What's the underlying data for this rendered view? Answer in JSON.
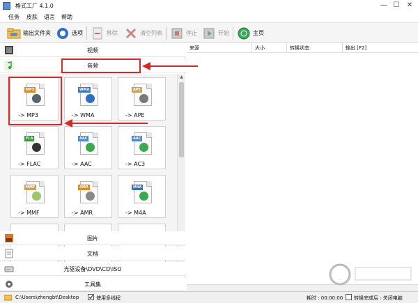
{
  "window": {
    "title": "格式工厂 4.1.0",
    "controls": {
      "minimize": "—",
      "maximize": "☐",
      "close": "✕"
    }
  },
  "menu": [
    "任务",
    "皮肤",
    "语言",
    "帮助"
  ],
  "toolbar": {
    "output_folder": "输出文件夹",
    "options": "选项",
    "remove": "移除",
    "clear_list": "清空列表",
    "stop": "停止",
    "start": "开始",
    "home": "主页"
  },
  "categories": {
    "video": "视频",
    "audio": "音频",
    "picture": "图片",
    "document": "文档",
    "rom": "光驱设备\\DVD\\CD\\ISO",
    "tools": "工具集"
  },
  "tiles": [
    {
      "tag": "MP3",
      "label": "-> MP3",
      "color": "#e08a1e"
    },
    {
      "tag": "WMA",
      "label": "-> WMA",
      "color": "#3b79c8"
    },
    {
      "tag": "APE",
      "label": "-> APE",
      "color": "#c9a15a"
    },
    {
      "tag": "FLA",
      "label": "-> FLAC",
      "color": "#3a9a3a"
    },
    {
      "tag": "AAC",
      "label": "-> AAC",
      "color": "#4a88d8"
    },
    {
      "tag": "AAC",
      "label": "-> AC3",
      "color": "#4a88d8"
    },
    {
      "tag": "MMF",
      "label": "-> MMF",
      "color": "#c9a15a"
    },
    {
      "tag": "AMR",
      "label": "-> AMR",
      "color": "#e08a1e"
    },
    {
      "tag": "M4A",
      "label": "-> M4A",
      "color": "#3b6fb8"
    }
  ],
  "table": {
    "columns": [
      "来源",
      "大小",
      "转换状态",
      "输出 [F2]"
    ]
  },
  "status": {
    "path": "C:\\Users\\zhengbt\\Desktop",
    "multithread": "使用多线程",
    "elapsed": "耗时 : 00:00:00",
    "after_done": "转换完成后 : 关闭电脑"
  },
  "colors": {
    "highlight": "#e02424",
    "toolbar_bg": "#f5f5f5"
  }
}
